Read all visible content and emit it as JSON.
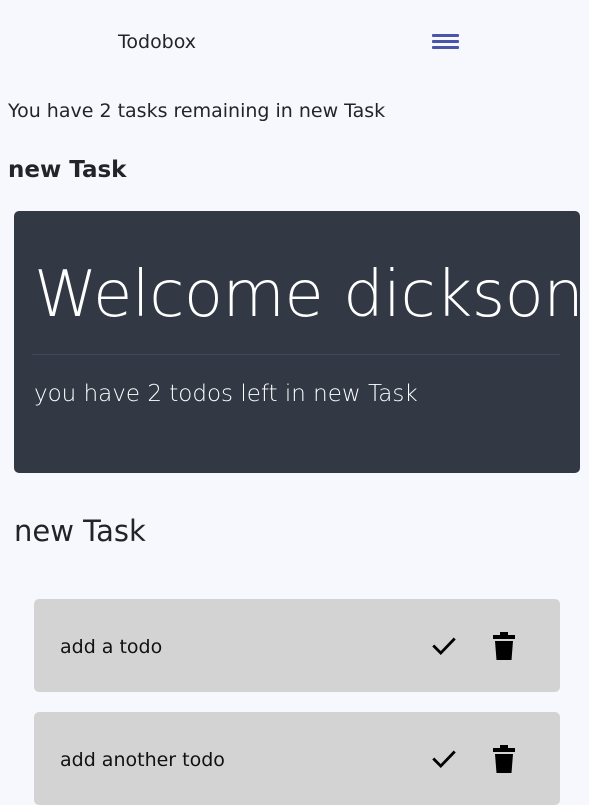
{
  "navbar": {
    "brand": "Todobox",
    "menu_icon": "hamburger-menu-icon",
    "accent_color": "#4a54a8"
  },
  "summary": {
    "remaining_text": "You have 2 tasks remaining in new Task"
  },
  "section": {
    "title": "new Task"
  },
  "jumbotron": {
    "heading": "Welcome dickson",
    "subtext": "you have 2 todos left in new Task",
    "background_color": "#323844"
  },
  "todo_list": {
    "title": "new Task",
    "items": [
      {
        "text": "add a todo",
        "complete_icon": "checkmark-icon",
        "delete_icon": "trash-icon"
      },
      {
        "text": "add another todo",
        "complete_icon": "checkmark-icon",
        "delete_icon": "trash-icon"
      }
    ],
    "item_background": "#d3d3d3"
  }
}
